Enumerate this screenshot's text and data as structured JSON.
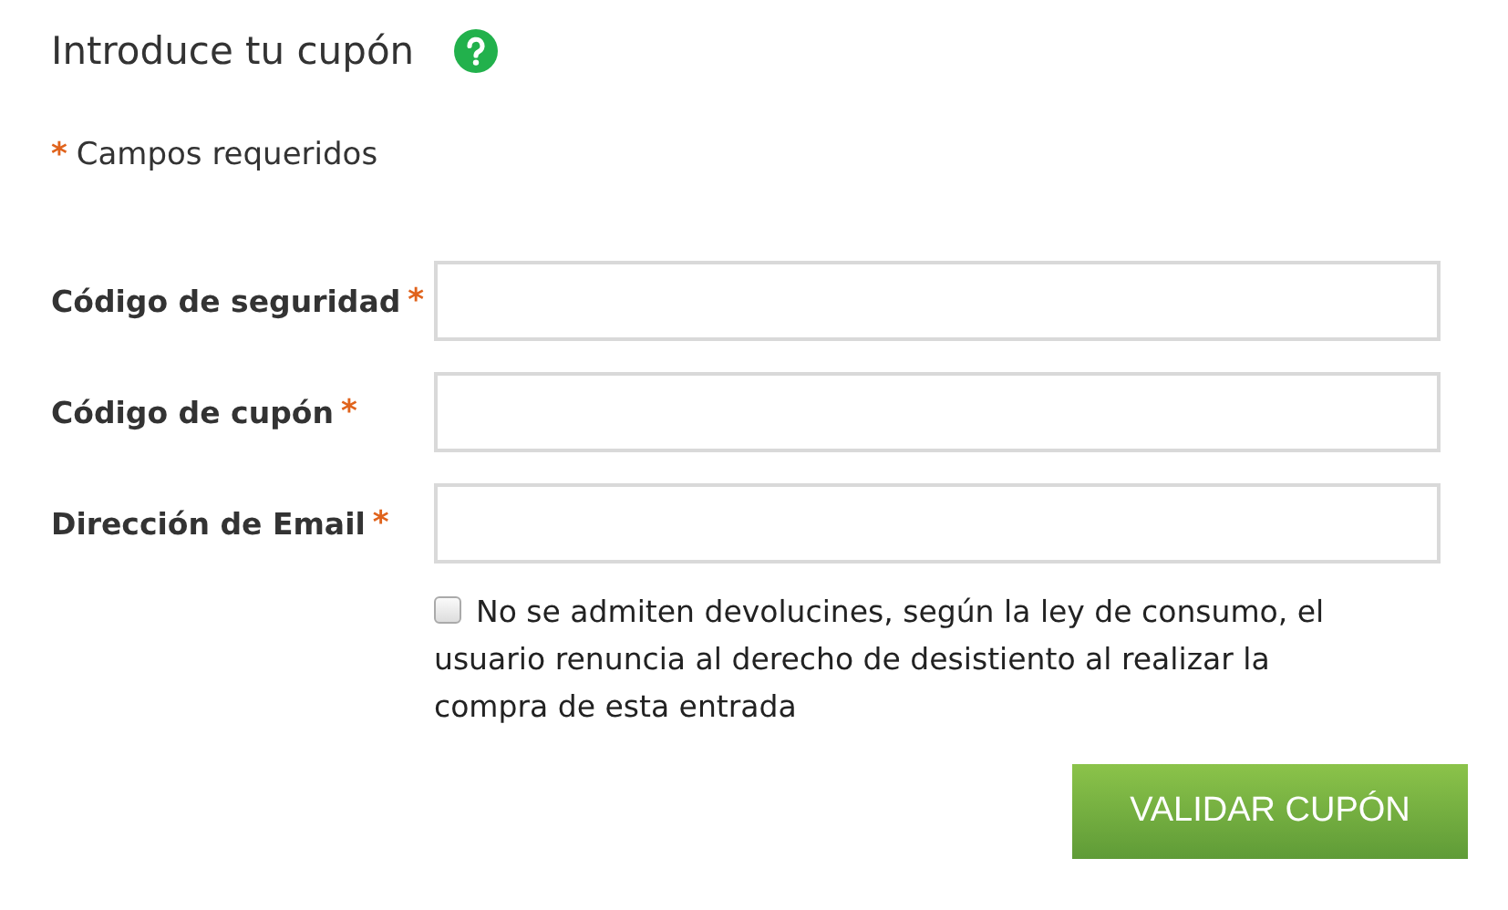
{
  "heading": {
    "title": "Introduce tu cupón"
  },
  "required_note": {
    "mark": "*",
    "text": "Campos requeridos"
  },
  "fields": [
    {
      "label": "Código de seguridad",
      "mark": "*"
    },
    {
      "label": "Código de cupón",
      "mark": "*"
    },
    {
      "label": "Dirección de Email",
      "mark": "*"
    }
  ],
  "consent": {
    "checked": false,
    "text": "No se admiten devolucines, según la ley de consumo, el usuario renuncia al derecho de desistiento al realizar la compra de esta entrada"
  },
  "submit": {
    "label": "VALIDAR CUPÓN"
  }
}
